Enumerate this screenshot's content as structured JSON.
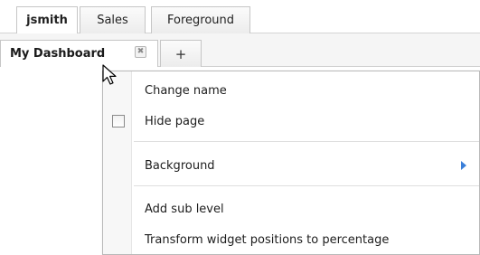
{
  "top_tabs": [
    {
      "label": "jsmith"
    },
    {
      "label": "Sales"
    },
    {
      "label": "Foreground"
    }
  ],
  "dashboard_tabs": {
    "active_label": "My Dashboard",
    "close_glyph": "✖",
    "add_label": "+"
  },
  "context_menu": {
    "items": [
      {
        "label": "Change name"
      },
      {
        "label": "Hide page",
        "checked": false
      },
      {
        "label": "Background",
        "has_submenu": true
      },
      {
        "label": "Add sub level"
      },
      {
        "label": "Transform widget positions to percentage"
      }
    ],
    "submenu_arrow_color": "#3b7fd9"
  }
}
